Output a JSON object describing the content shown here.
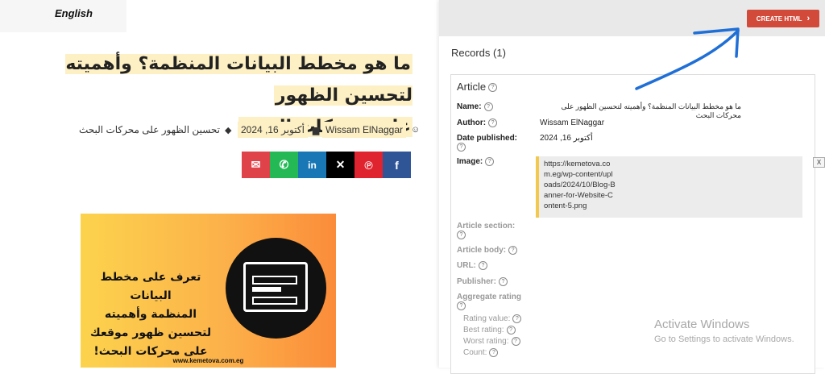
{
  "page": {
    "language_label": "English",
    "title_line1": "ما هو مخطط البيانات المنظمة؟ وأهميته لتحسين الظهور",
    "title_line2": "على محركات البحث",
    "author": "Wissam ElNaggar",
    "date": "أكتوبر 16, 2024",
    "category": "تحسين الظهور على محركات البحث",
    "share_buttons": [
      {
        "icon": "email-icon",
        "color": "#e0424a"
      },
      {
        "icon": "whatsapp-icon",
        "color": "#25b956"
      },
      {
        "icon": "linkedin-icon",
        "color": "#1a77b6"
      },
      {
        "icon": "x-icon",
        "color": "#000000"
      },
      {
        "icon": "pinterest-icon",
        "color": "#e0242f"
      },
      {
        "icon": "facebook-icon",
        "color": "#2f5597"
      }
    ],
    "banner": {
      "text_lines": [
        "تعرف على مخطط البيانات",
        "المنظمة وأهميته",
        "لتحسين ظهور موقعك",
        "على محركات البحث!"
      ],
      "site": "www.kemetova.com.eg"
    }
  },
  "panel": {
    "create_button_label": "CREATE HTML",
    "records_label": "Records (1)",
    "article_title": "Article",
    "fields": {
      "name_label": "Name:",
      "name_value": "ما هو مخطط البيانات المنظمة؟ وأهميته لتحسين الظهور على محركات البحث",
      "author_label": "Author:",
      "author_value": "Wissam ElNaggar",
      "date_label": "Date published:",
      "date_value": "أكتوبر 16, 2024",
      "image_label": "Image:",
      "image_value": "https://kemetova.com.eg/wp-content/uploads/2024/10/Blog-Banner-for-Website-Content-5.png",
      "image_remove": "X",
      "section_label": "Article section:",
      "body_label": "Article body:",
      "url_label": "URL:",
      "publisher_label": "Publisher:",
      "aggregate_label": "Aggregate rating",
      "rating_value_label": "Rating value:",
      "best_rating_label": "Best rating:",
      "worst_rating_label": "Worst rating:",
      "count_label": "Count:"
    }
  },
  "watermark": {
    "line1": "Activate Windows",
    "line2": "Go to Settings to activate Windows."
  }
}
